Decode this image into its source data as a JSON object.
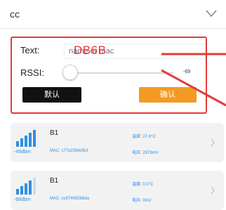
{
  "device_select": {
    "value": "cc"
  },
  "filter": {
    "text_label": "Text:",
    "text_placeholder": "name or mac",
    "annotation": "DB6B",
    "rssi_label": "RSSI:",
    "rssi_value": "-69",
    "rssi_fraction": 0.05,
    "default_button": "默认",
    "confirm_button": "确认"
  },
  "colors": {
    "accent_orange": "#f39a23",
    "annot_red": "#e23b3b",
    "signal_blue": "#2f8fe0"
  },
  "devices": [
    {
      "name": "B1",
      "rssi": "-45dbm",
      "mac": "MAC: c77e23feb0b3",
      "temp": "温度: 27.6°C",
      "volt": "电压: 2978mV",
      "signal_icon": "signal-bars-icon"
    },
    {
      "name": "B1",
      "rssi": "-66dbm",
      "mac": "MAC: cc874082b6da",
      "temp": "温度: 0.0°C",
      "volt": "电压: 0mV",
      "signal_icon": "signal-bars-icon"
    }
  ]
}
